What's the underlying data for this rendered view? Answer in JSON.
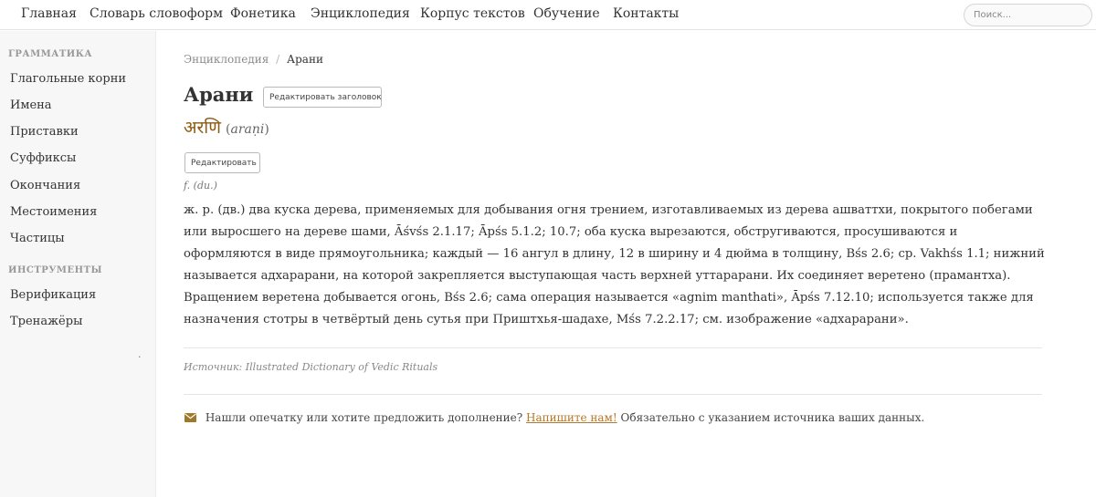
{
  "topnav": {
    "items": [
      "Главная",
      "Словарь словоформ",
      "Фонетика",
      "Энциклопедия",
      "Корпус текстов",
      "Обучение",
      "Контакты"
    ],
    "search_placeholder": "Поиск..."
  },
  "sidebar": {
    "sections": [
      {
        "title": "ГРАММАТИКА",
        "items": [
          "Глагольные корни",
          "Имена",
          "Приставки",
          "Суффиксы",
          "Окончания",
          "Местоимения",
          "Частицы"
        ]
      },
      {
        "title": "ИНСТРУМЕНТЫ",
        "items": [
          "Верификация",
          "Тренажёры"
        ]
      }
    ],
    "expander": "·"
  },
  "breadcrumb": {
    "parent": "Энциклопедия",
    "separator": "/",
    "current": "Арани"
  },
  "entry": {
    "title": "Арани",
    "edit_title_label": "Редактировать заголовок",
    "devanagari": "अरणि",
    "translit_open": "(",
    "translit": "araṇi",
    "translit_close": ")",
    "edit_label": "Редактировать",
    "grammar": "f. (du.)",
    "definition": "ж. р. (дв.) два куска дерева, применяемых для добывания огня трением, изготавливаемых из дерева ашваттхи, покрытого побегами или выросшего на дереве шами, Āśvśs 2.1.17; Āpśs 5.1.2; 10.7; оба куска вырезаются, обстругиваются, просушиваются и оформляются в виде прямоугольника; каждый — 16 ангул в длину, 12 в ширину и 4 дюйма в толщину, Bśs 2.6; ср. Vakhśs 1.1; нижний называется адхарарани, на которой закрепляется выступающая часть верхней уттарарани. Их соединяет веретено (прамантха). Вращением веретена добывается огонь, Bśs 2.6; сама операция называется «agnim manthati», Āpśs 7.12.10; используется также для назначения стотры в четвёртый день сутья при Приштхья-шадахе, Mśs 7.2.2.17; см. изображение «адхарарани».",
    "source_label": "Источник:",
    "source_title": "Illustrated Dictionary of Vedic Rituals"
  },
  "feedback": {
    "text_before": "Нашли опечатку или хотите предложить дополнение?",
    "link": "Напишите нам!",
    "text_after": "Обязательно с указанием источника ваших данных."
  },
  "colors": {
    "accent": "#b5782a",
    "devanagari": "#8b5a12",
    "sidebar_bg": "#f7f7f7",
    "icon": "#a0782a"
  },
  "icons": {
    "feedback": "envelope-icon"
  }
}
